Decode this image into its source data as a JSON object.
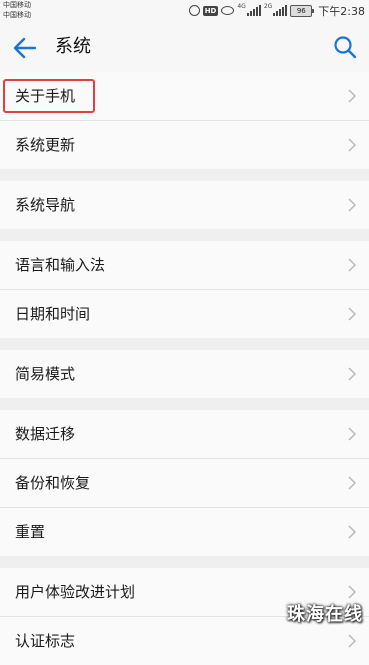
{
  "status_bar": {
    "carrier1": "中国移动",
    "carrier2": "中国移动",
    "hd": "HD",
    "net1": "4G",
    "net2": "2G",
    "battery": "96",
    "time": "下午2:38"
  },
  "header": {
    "title": "系统",
    "back_icon": "arrow-left-icon",
    "search_icon": "search-icon",
    "accent_color": "#1a73d9"
  },
  "groups": [
    {
      "items": [
        {
          "label": "关于手机",
          "highlighted": true
        },
        {
          "label": "系统更新"
        }
      ]
    },
    {
      "items": [
        {
          "label": "系统导航"
        }
      ]
    },
    {
      "items": [
        {
          "label": "语言和输入法"
        },
        {
          "label": "日期和时间"
        }
      ]
    },
    {
      "items": [
        {
          "label": "简易模式"
        }
      ]
    },
    {
      "items": [
        {
          "label": "数据迁移"
        },
        {
          "label": "备份和恢复"
        },
        {
          "label": "重置"
        }
      ]
    },
    {
      "items": [
        {
          "label": "用户体验改进计划"
        },
        {
          "label": "认证标志"
        }
      ]
    }
  ],
  "watermark": "珠海在线",
  "highlight_color": "#e0403f"
}
